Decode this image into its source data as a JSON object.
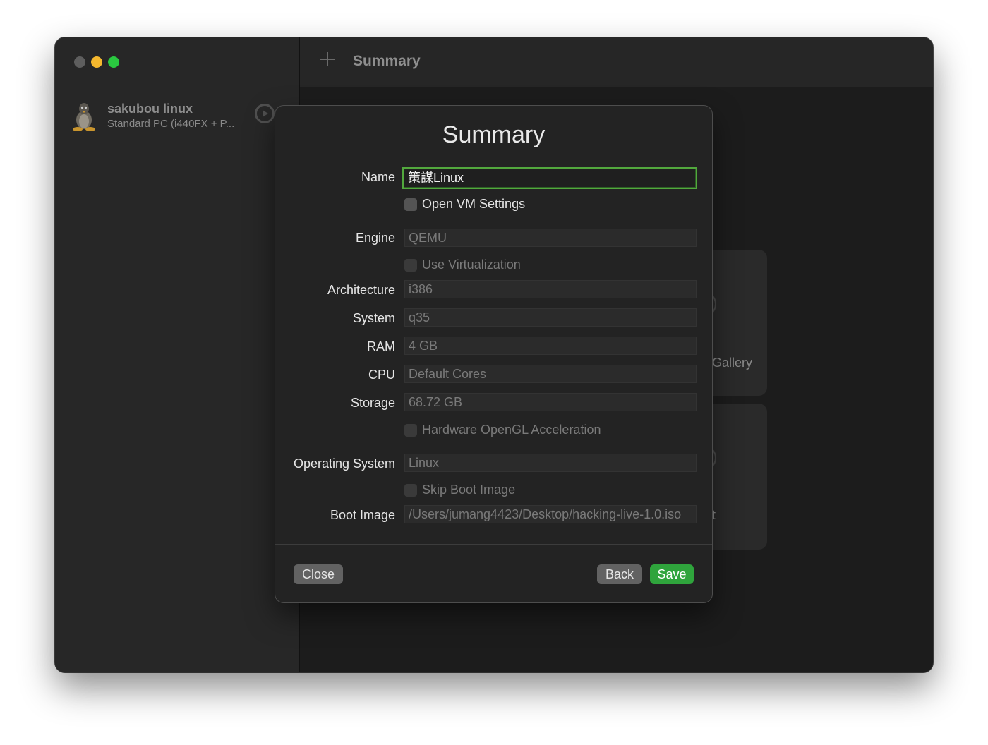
{
  "sidebar": {
    "vm": {
      "name": "sakubou linux",
      "description": "Standard PC (i440FX + P..."
    }
  },
  "toolbar": {
    "title": "Summary"
  },
  "background_cards": [
    {
      "label": "Gallery"
    },
    {
      "label": "t"
    }
  ],
  "dialog": {
    "title": "Summary",
    "name_label": "Name",
    "name_value": "策謀Linux",
    "open_vm_settings_label": "Open VM Settings",
    "engine_label": "Engine",
    "engine_value": "QEMU",
    "use_virtualization_label": "Use Virtualization",
    "architecture_label": "Architecture",
    "architecture_value": "i386",
    "system_label": "System",
    "system_value": "q35",
    "ram_label": "RAM",
    "ram_value": "4 GB",
    "cpu_label": "CPU",
    "cpu_value": "Default Cores",
    "storage_label": "Storage",
    "storage_value": "68.72 GB",
    "hardware_opengl_label": "Hardware OpenGL Acceleration",
    "os_label": "Operating System",
    "os_value": "Linux",
    "skip_boot_image_label": "Skip Boot Image",
    "boot_image_label": "Boot Image",
    "boot_image_value": "/Users/jumang4423/Desktop/hacking-live-1.0.iso",
    "buttons": {
      "close": "Close",
      "back": "Back",
      "save": "Save"
    }
  },
  "colors": {
    "accent_green": "#2fa43c",
    "focus_ring": "#52a83d",
    "traffic_yellow": "#f5b82e",
    "traffic_green": "#2ac840"
  }
}
